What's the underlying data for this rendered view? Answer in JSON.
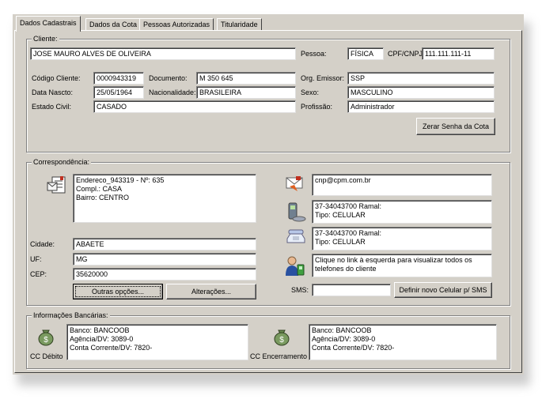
{
  "tabs": [
    "Dados Cadastrais",
    "Dados da Cota",
    "Pessoas Autorizadas",
    "Titularidade"
  ],
  "cliente": {
    "legend": "Cliente:",
    "nome": "JOSE MAURO ALVES DE OLIVEIRA",
    "pessoa_label": "Pessoa:",
    "pessoa": "FÍSICA",
    "cpf_label": "CPF/CNPJ:",
    "cpf": "111.111.111-11",
    "codigo_label": "Código Cliente:",
    "codigo": "0000943319",
    "documento_label": "Documento:",
    "documento": "M 350 645",
    "orgao_label": "Org. Emissor:",
    "orgao": "SSP",
    "nascto_label": "Data Nascto:",
    "nascto": "25/05/1964",
    "nacionalidade_label": "Nacionalidade:",
    "nacionalidade": "BRASILEIRA",
    "sexo_label": "Sexo:",
    "sexo": "MASCULINO",
    "civil_label": "Estado Civil:",
    "civil": "CASADO",
    "profissao_label": "Profissão:",
    "profissao": "Administrador",
    "zerar_label": "Zerar Senha da Cota"
  },
  "correspondencia": {
    "legend": "Correspondência:",
    "endereco1": "Endereco_943319 - Nº: 635",
    "endereco2": "Compl.: CASA",
    "endereco3": "Bairro: CENTRO",
    "cidade_label": "Cidade:",
    "cidade": "ABAETE",
    "uf_label": "UF:",
    "uf": "MG",
    "cep_label": "CEP:",
    "cep": "35620000",
    "outras_label": "Outras opções...",
    "alteracoes_label": "Alterações...",
    "email": "cnp@cpm.com.br",
    "cel_line1": "37-34043700    Ramal:",
    "cel_line2": "Tipo: CELULAR",
    "tel_line1": "37-34043700    Ramal:",
    "tel_line2": "Tipo: CELULAR",
    "info": "Clique no link à esquerda para visualizar todos os telefones do cliente",
    "sms_label": "SMS:",
    "sms_value": "",
    "definir_label": "Definir novo Celular p/ SMS"
  },
  "bancarias": {
    "legend": "Informações Bancárias:",
    "debito_label": "CC Débito",
    "debito_l1": "Banco: BANCOOB",
    "debito_l2": "Agência/DV: 3089-0",
    "debito_l3": "Conta Corrente/DV: 7820-",
    "enc_label": "CC Encerramento",
    "enc_l1": "Banco: BANCOOB",
    "enc_l2": "Agência/DV: 3089-0",
    "enc_l3": "Conta Corrente/DV: 7820-"
  }
}
